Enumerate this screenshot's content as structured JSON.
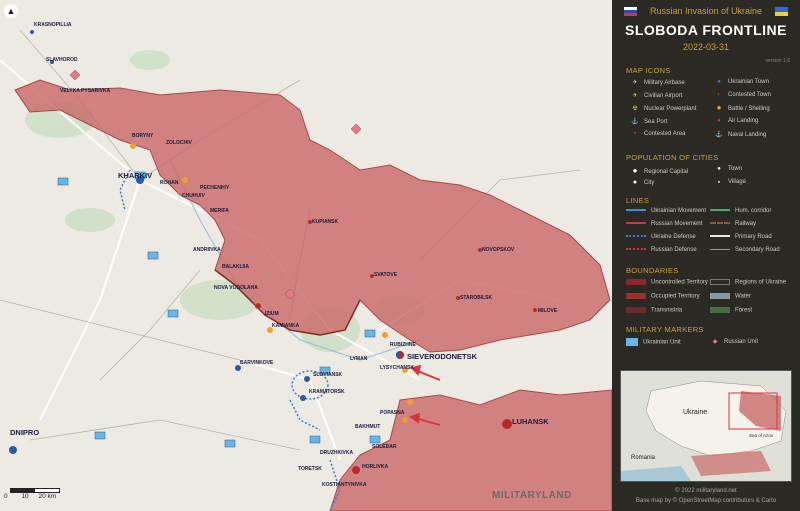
{
  "header": {
    "top_title": "Russian Invasion of Ukraine",
    "main_title": "SLOBODA FRONTLINE",
    "date": "2022-03-31",
    "version": "version 1.6"
  },
  "legend": {
    "map_icons_title": "MAP ICONS",
    "map_icons": [
      {
        "label": "Military Airbase",
        "icon": "airplane-icon"
      },
      {
        "label": "Ukrainian Town",
        "icon": "blue-dot-icon"
      },
      {
        "label": "Civilian Airport",
        "icon": "airport-icon"
      },
      {
        "label": "Contested Town",
        "icon": "half-dot-icon"
      },
      {
        "label": "Nuclear Powerplant",
        "icon": "nuclear-icon"
      },
      {
        "label": "Battle / Shelling",
        "icon": "fire-icon"
      },
      {
        "label": "Sea Port",
        "icon": "anchor-icon"
      },
      {
        "label": "Air Landing",
        "icon": "parachute-icon"
      },
      {
        "label": "Contested Area",
        "icon": "contested-dot-icon"
      },
      {
        "label": "Naval Landing",
        "icon": "naval-icon"
      }
    ],
    "population_title": "POPULATION OF CITIES",
    "population": [
      {
        "label": "Regional Capital"
      },
      {
        "label": "Town"
      },
      {
        "label": "City"
      },
      {
        "label": "Village"
      }
    ],
    "lines_title": "LINES",
    "lines": [
      {
        "label": "Ukrainian Movement",
        "color": "#3a8fd9"
      },
      {
        "label": "Hum. corridor",
        "color": "#3fae6a"
      },
      {
        "label": "Russian Movement",
        "color": "#d9343a"
      },
      {
        "label": "Railway",
        "color": "#8a5a3a"
      },
      {
        "label": "Ukraine Defense",
        "color": "#3a7ad9"
      },
      {
        "label": "Primary Road",
        "color": "#e8e8e8"
      },
      {
        "label": "Russian Defense",
        "color": "#d9343a"
      },
      {
        "label": "Secondary Road",
        "color": "#9a9a9a"
      }
    ],
    "boundaries_title": "BOUNDARIES",
    "boundaries": [
      {
        "label": "Uncontrolled Territory",
        "color": "#8a2a28"
      },
      {
        "label": "Regions of Ukraine",
        "color": "#2a2924"
      },
      {
        "label": "Occupied Territory",
        "color": "#9c3230"
      },
      {
        "label": "Water",
        "color": "#8a9aa0"
      },
      {
        "label": "Transnistria",
        "color": "#6a2a28"
      },
      {
        "label": "Forest",
        "color": "#4a6a40"
      }
    ],
    "markers_title": "MILITARY MARKERS",
    "markers": [
      {
        "label": "Ukrainian Unit",
        "color": "#6ab4e8"
      },
      {
        "label": "Russian Unit",
        "color": "#e07a8a"
      }
    ]
  },
  "inset": {
    "labels": [
      "Ukraine",
      "Romania",
      "Sea of Azov"
    ]
  },
  "footer": {
    "copyright": "© 2022 militaryland.net",
    "basemap": "Base map by © OpenStreetMap contributors & Carto"
  },
  "map": {
    "watermark": "MILITARYLAND",
    "scale": [
      "0",
      "10",
      "20 km"
    ],
    "cities_major": [
      "KHARKIV",
      "SIEVERODONETSK",
      "LUHANSK",
      "DNIPRO",
      "BARVINKOVE",
      "SLOVIANSK",
      "KRAMATORSK",
      "HORLIVKA",
      "IZIUM"
    ],
    "cities_minor": [
      "KRASNOPILLIA",
      "SLAVHOROD",
      "VELYKA PYSARIVKA",
      "BORYNY",
      "ROHAN",
      "CHUHUIV",
      "KUPIANSK",
      "STAROBILSK",
      "SVATOVE",
      "NOVOPSKOV",
      "BALAKLIIA",
      "ANDRIIVKA",
      "LYMAN",
      "RUBIZHNE",
      "LYSYCHANSK",
      "POPASNA",
      "BAKHMUT",
      "SOLEDAR",
      "TORETSK",
      "KOSTIANTYNIVKA",
      "DRUZHKIVKA",
      "MERIFA",
      "ZOLOCHIV",
      "NOVA VODOLAHA",
      "PECHENIHY",
      "KAMIANKA",
      "MILOVE"
    ]
  },
  "colors": {
    "occupied": "#c96a6a",
    "occupied_dark": "#b85555",
    "land": "#eceae2",
    "panel": "#2a2924",
    "accent": "#c9a13a"
  }
}
